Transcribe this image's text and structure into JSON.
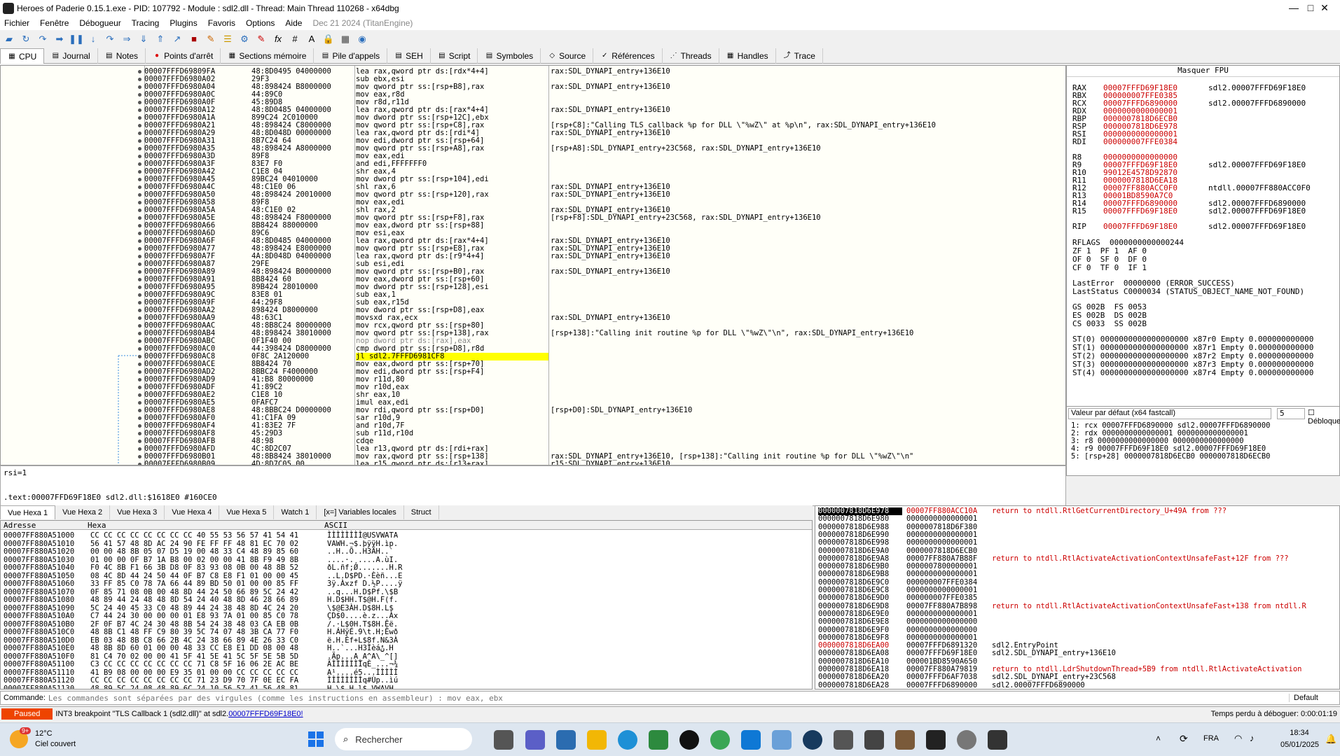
{
  "window": {
    "title": "Heroes of Paderie 0.15.1.exe - PID: 107792 - Module : sdl2.dll - Thread: Main Thread 110268 - x64dbg",
    "controls": {
      "min": "—",
      "max": "□",
      "close": "✕"
    }
  },
  "menu": {
    "items": [
      "Fichier",
      "Fenêtre",
      "Débogueur",
      "Tracing",
      "Plugins",
      "Favoris",
      "Options",
      "Aide"
    ],
    "date": "Dec 21 2024 (TitanEngine)"
  },
  "tabs": [
    "CPU",
    "Journal",
    "Notes",
    "Points d'arrêt",
    "Sections mémoire",
    "Pile d'appels",
    "SEH",
    "Script",
    "Symboles",
    "Source",
    "Références",
    "Threads",
    "Handles",
    "Trace"
  ],
  "disasm": [
    [
      "00007FFFD69809FA",
      "48:8D0495 04000000",
      "lea rax,qword ptr ds:[rdx*4+4]",
      "rax:SDL_DYNAPI_entry+136E10"
    ],
    [
      "00007FFFD6980A02",
      "29F3",
      "sub ebx,esi",
      ""
    ],
    [
      "00007FFFD6980A04",
      "48:898424 B8000000",
      "mov qword ptr ss:[rsp+B8],rax",
      "rax:SDL_DYNAPI_entry+136E10"
    ],
    [
      "00007FFFD6980A0C",
      "44:89C0",
      "mov eax,r8d",
      ""
    ],
    [
      "00007FFFD6980A0F",
      "45:89D8",
      "mov r8d,r11d",
      ""
    ],
    [
      "00007FFFD6980A12",
      "48:8D0485 04000000",
      "lea rax,qword ptr ds:[rax*4+4]",
      "rax:SDL_DYNAPI_entry+136E10"
    ],
    [
      "00007FFFD6980A1A",
      "899C24 2C010000",
      "mov dword ptr ss:[rsp+12C],ebx",
      ""
    ],
    [
      "00007FFFD6980A21",
      "48:898424 C8000000",
      "mov qword ptr ss:[rsp+C8],rax",
      "[rsp+C8]:\"Calling TLS callback %p for DLL \\\"%wZ\\\" at %p\\n\", rax:SDL_DYNAPI_entry+136E10"
    ],
    [
      "00007FFFD6980A29",
      "48:8D048D 00000000",
      "lea rax,qword ptr ds:[rdi*4]",
      "rax:SDL_DYNAPI_entry+136E10"
    ],
    [
      "00007FFFD6980A31",
      "8B7C24 64",
      "mov edi,dword ptr ss:[rsp+64]",
      ""
    ],
    [
      "00007FFFD6980A35",
      "48:898424 A8000000",
      "mov qword ptr ss:[rsp+A8],rax",
      "[rsp+A8]:SDL_DYNAPI_entry+23C568, rax:SDL_DYNAPI_entry+136E10"
    ],
    [
      "00007FFFD6980A3D",
      "89F8",
      "mov eax,edi",
      ""
    ],
    [
      "00007FFFD6980A3F",
      "83E7 F0",
      "and edi,FFFFFFF0",
      ""
    ],
    [
      "00007FFFD6980A42",
      "C1E8 04",
      "shr eax,4",
      ""
    ],
    [
      "00007FFFD6980A45",
      "89BC24 04010000",
      "mov dword ptr ss:[rsp+104],edi",
      ""
    ],
    [
      "00007FFFD6980A4C",
      "48:C1E0 06",
      "shl rax,6",
      "rax:SDL_DYNAPI_entry+136E10"
    ],
    [
      "00007FFFD6980A50",
      "48:898424 20010000",
      "mov qword ptr ss:[rsp+120],rax",
      "rax:SDL_DYNAPI_entry+136E10"
    ],
    [
      "00007FFFD6980A58",
      "89F8",
      "mov eax,edi",
      ""
    ],
    [
      "00007FFFD6980A5A",
      "48:C1E0 02",
      "shl rax,2",
      "rax:SDL_DYNAPI_entry+136E10"
    ],
    [
      "00007FFFD6980A5E",
      "48:898424 F8000000",
      "mov qword ptr ss:[rsp+F8],rax",
      "[rsp+F8]:SDL_DYNAPI_entry+23C568, rax:SDL_DYNAPI_entry+136E10"
    ],
    [
      "00007FFFD6980A66",
      "8B8424 88000000",
      "mov eax,dword ptr ss:[rsp+88]",
      ""
    ],
    [
      "00007FFFD6980A6D",
      "89C6",
      "mov esi,eax",
      ""
    ],
    [
      "00007FFFD6980A6F",
      "48:8D0485 04000000",
      "lea rax,qword ptr ds:[rax*4+4]",
      "rax:SDL_DYNAPI_entry+136E10"
    ],
    [
      "00007FFFD6980A77",
      "48:898424 E8000000",
      "mov qword ptr ss:[rsp+E8],rax",
      "rax:SDL_DYNAPI_entry+136E10"
    ],
    [
      "00007FFFD6980A7F",
      "4A:8D048D 04000000",
      "lea rax,qword ptr ds:[r9*4+4]",
      "rax:SDL_DYNAPI_entry+136E10"
    ],
    [
      "00007FFFD6980A87",
      "29FE",
      "sub esi,edi",
      ""
    ],
    [
      "00007FFFD6980A89",
      "48:898424 B0000000",
      "mov qword ptr ss:[rsp+B0],rax",
      "rax:SDL_DYNAPI_entry+136E10"
    ],
    [
      "00007FFFD6980A91",
      "8B8424 60",
      "mov eax,dword ptr ss:[rsp+60]",
      ""
    ],
    [
      "00007FFFD6980A95",
      "89B424 28010000",
      "mov dword ptr ss:[rsp+128],esi",
      ""
    ],
    [
      "00007FFFD6980A9C",
      "83E8 01",
      "sub eax,1",
      ""
    ],
    [
      "00007FFFD6980A9F",
      "44:29F8",
      "sub eax,r15d",
      ""
    ],
    [
      "00007FFFD6980AA2",
      "898424 D8000000",
      "mov dword ptr ss:[rsp+D8],eax",
      ""
    ],
    [
      "00007FFFD6980AA9",
      "48:63C1",
      "movsxd rax,ecx",
      "rax:SDL_DYNAPI_entry+136E10"
    ],
    [
      "00007FFFD6980AAC",
      "48:8B8C24 80000000",
      "mov rcx,qword ptr ss:[rsp+80]",
      ""
    ],
    [
      "00007FFFD6980AB4",
      "48:898424 38010000",
      "mov qword ptr ss:[rsp+138],rax",
      "[rsp+138]:\"Calling init routine %p for DLL \\\"%wZ\\\"\\n\", rax:SDL_DYNAPI_entry+136E10"
    ],
    [
      "00007FFFD6980ABC",
      "0F1F40 00",
      "nop dword ptr ds:[rax],eax",
      ""
    ],
    [
      "00007FFFD6980AC0",
      "44:398424 D8000000",
      "cmp dword ptr ss:[rsp+D8],r8d",
      ""
    ],
    [
      "00007FFFD6980AC8",
      "0F8C 2A120000",
      "jl sdl2.7FFFD6981CF8",
      ""
    ],
    [
      "00007FFFD6980ACE",
      "8B8424 70",
      "mov eax,dword ptr ss:[rsp+70]",
      ""
    ],
    [
      "00007FFFD6980AD2",
      "8BBC24 F4000000",
      "mov edi,dword ptr ss:[rsp+F4]",
      ""
    ],
    [
      "00007FFFD6980AD9",
      "41:B8 80000000",
      "mov r11d,80",
      ""
    ],
    [
      "00007FFFD6980ADF",
      "41:89C2",
      "mov r10d,eax",
      ""
    ],
    [
      "00007FFFD6980AE2",
      "C1E8 10",
      "shr eax,10",
      ""
    ],
    [
      "00007FFFD6980AE5",
      "0FAFC7",
      "imul eax,edi",
      ""
    ],
    [
      "00007FFFD6980AE8",
      "48:8BBC24 D0000000",
      "mov rdi,qword ptr ss:[rsp+D0]",
      "[rsp+D0]:SDL_DYNAPI_entry+136E10"
    ],
    [
      "00007FFFD6980AF0",
      "41:C1FA 09",
      "sar r10d,9",
      ""
    ],
    [
      "00007FFFD6980AF4",
      "41:83E2 7F",
      "and r10d,7F",
      ""
    ],
    [
      "00007FFFD6980AF8",
      "45:29D3",
      "sub r11d,r10d",
      ""
    ],
    [
      "00007FFFD6980AFB",
      "48:98",
      "cdqe",
      ""
    ],
    [
      "00007FFFD6980AFD",
      "4C:8D2C07",
      "lea r13,qword ptr ds:[rdi+rax]",
      ""
    ],
    [
      "00007FFFD6980B01",
      "48:8B8424 38010000",
      "mov rax,qword ptr ss:[rsp+138]",
      "rax:SDL_DYNAPI_entry+136E10, [rsp+138]:\"Calling init routine %p for DLL \\\"%wZ\\\"\\n\""
    ],
    [
      "00007FFFD6980B09",
      "4D:8D7C05 00",
      "lea r15,qword ptr ds:[r13+rax]",
      "r15:SDL_DYNAPI_entry+136E10"
    ]
  ],
  "info": {
    "line1": "rsi=1",
    "line2": ".text:00007FFD69F18E0 sdl2.dll:$1618E0 #160CE0"
  },
  "registers": {
    "header": "Masquer FPU",
    "gp": [
      [
        "RAX",
        "00007FFFD69F18E0",
        "sdl2.00007FFFD69F18E0"
      ],
      [
        "RBX",
        "000000007FFE0385",
        ""
      ],
      [
        "RCX",
        "00007FFFD6890000",
        "sdl2.00007FFFD6890000"
      ],
      [
        "RDX",
        "0000000000000001",
        ""
      ],
      [
        "RBP",
        "0000007818D6ECB0",
        ""
      ],
      [
        "RSP",
        "0000007818D6E978",
        ""
      ],
      [
        "RSI",
        "0000000000000001",
        ""
      ],
      [
        "RDI",
        "000000007FFE0384",
        ""
      ],
      [
        "R8",
        "0000000000000000",
        ""
      ],
      [
        "R9",
        "00007FFFD69F18E0",
        "sdl2.00007FFFD69F18E0"
      ],
      [
        "R10",
        "99012E4578D92870",
        ""
      ],
      [
        "R11",
        "0000007818D6EA18",
        ""
      ],
      [
        "R12",
        "00007FF880ACC0F0",
        "ntdll.00007FF880ACC0F0"
      ],
      [
        "R13",
        "00001BD8590A7C0",
        ""
      ],
      [
        "R14",
        "00007FFFD6890000",
        "sdl2.00007FFFD6890000"
      ],
      [
        "R15",
        "00007FFFD69F18E0",
        "sdl2.00007FFFD69F18E0"
      ],
      [
        "RIP",
        "00007FFFD69F18E0",
        "sdl2.00007FFFD69F18E0"
      ]
    ],
    "rflags": "RFLAGS  0000000000000244",
    "flags": [
      "ZF 1  PF 1  AF 0",
      "OF 0  SF 0  DF 0",
      "CF 0  TF 0  IF 1"
    ],
    "lasterror": "LastError  00000000 (ERROR_SUCCESS)",
    "laststatus": "LastStatus C0000034 (STATUS_OBJECT_NAME_NOT_FOUND)",
    "segs": [
      "GS 002B  FS 0053",
      "ES 002B  DS 002B",
      "CS 0033  SS 002B"
    ],
    "fpu": [
      "ST(0) 0000000000000000000 x87r0 Empty 0.000000000000",
      "ST(1) 0000000000000000000 x87r1 Empty 0.000000000000",
      "ST(2) 0000000000000000000 x87r2 Empty 0.000000000000",
      "ST(3) 0000000000000000000 x87r3 Empty 0.000000000000",
      "ST(4) 0000000000000000000 x87r4 Empty 0.000000000000"
    ]
  },
  "fastcall": {
    "select": "Valeur par défaut (x64 fastcall)",
    "count": "5",
    "unlock": "Débloquer",
    "rows": [
      "1: rcx 00007FFFD6890000 sdl2.00007FFFD6890000",
      "2: rdx 0000000000000001 0000000000000001",
      "3: r8 0000000000000000 0000000000000000",
      "4: r9 00007FFFD69F18E0 sdl2.00007FFFD69F18E0",
      "5: [rsp+28] 0000007818D6ECB0 0000007818D6ECB0"
    ]
  },
  "btabs": [
    "Vue Hexa 1",
    "Vue Hexa 2",
    "Vue Hexa 3",
    "Vue Hexa 4",
    "Vue Hexa 5",
    "Watch 1",
    "[x=] Variables locales",
    "Struct"
  ],
  "hex": {
    "headers": [
      "Adresse",
      "Hexa",
      "ASCII"
    ],
    "rows": [
      [
        "00007FF880A51000",
        "CC CC CC CC CC CC CC CC 40 55 53 56 57 41 54 41",
        "ÌÌÌÌÌÌÌÌ@USVWATA"
      ],
      [
        "00007FF880A51010",
        "56 41 57 48 8D AC 24 90 FE FF FF 48 81 EC 70 02",
        "VAWH.¬$.þÿÿH.ìp."
      ],
      [
        "00007FF880A51020",
        "00 00 48 8B 05 07 D5 19 00 48 33 C4 48 89 85 60",
        "..H..Õ..H3ÄH..`"
      ],
      [
        "00007FF880A51030",
        "01 00 00 0F B7 1A B8 00 02 00 00 41 8B F9 49 8B",
        "....·.¸....A.ùI."
      ],
      [
        "00007FF880A51040",
        "F0 4C 8B F1 66 3B D8 0F 83 93 08 0B 00 48 8B 52",
        "ðL.ñf;Ø.......H.R"
      ],
      [
        "00007FF880A51050",
        "08 4C 8D 44 24 50 44 0F B7 C8 E8 F1 01 00 00 45",
        "..L.D$PD.·Èèñ...E"
      ],
      [
        "00007FF880A51060",
        "33 FF 85 C0 78 7A 66 44 89 BD 50 01 00 00 85 FF",
        "3ÿ.Àxzf D.½P....ÿ"
      ],
      [
        "00007FF880A51070",
        "0F 85 71 08 0B 00 48 8D 44 24 50 66 89 5C 24 42",
        "..q...H.D$Pf.\\$B"
      ],
      [
        "00007FF880A51080",
        "48 89 44 24 48 48 8D 54 24 40 48 8D 46 28 66 89",
        "H.D$HH.T$@H.F(f."
      ],
      [
        "00007FF880A51090",
        "5C 24 40 45 33 C0 48 89 44 24 38 48 8D 4C 24 20",
        "\\$@E3ÀH.D$8H.L$ "
      ],
      [
        "00007FF880A510A0",
        "C7 44 24 30 00 00 00 01 E8 93 7A 01 00 85 C0 78",
        "ÇD$0....è.z...Àx"
      ],
      [
        "00007FF880A510B0",
        "2F 0F B7 4C 24 30 48 8B 54 24 38 48 03 CA EB 0B",
        "/.·L$0H.T$8H.Êë."
      ],
      [
        "00007FF880A510C0",
        "48 8B C1 48 FF C9 80 39 5C 74 07 48 3B CA 77 F0",
        "H.ÁHÿÉ.9\\t.H;Êwð"
      ],
      [
        "00007FF880A510D0",
        "EB 03 48 8B C8 66 2B 4C 24 38 66 89 4E 26 33 C0",
        "ë.H.Èf+L$8f.N&3À"
      ],
      [
        "00007FF880A510E0",
        "48 8B 8D 60 01 00 00 48 33 CC E8 E1 DD 08 00 48",
        "H..`...H3Ìèáݨ.H"
      ],
      [
        "00007FF880A510F0",
        "81 C4 70 02 00 00 41 5F 41 5E 41 5C 5F 5E 5B 5D",
        ".Äp...A_A^A\\_^[]"
      ],
      [
        "00007FF880A51100",
        "C3 CC CC CC CC CC CC CC 71 C8 5F 16 06 2E AC BE",
        "ÃÌÌÌÌÌÌÌqÈ_...¬¾"
      ],
      [
        "00007FF880A51110",
        "41 B9 08 00 00 00 E9 35 01 00 00 CC CC CC CC CC",
        "A¹....é5...ÌÌÌÌÌ"
      ],
      [
        "00007FF880A51120",
        "CC CC CC CC CC CC CC CC 71 23 D9 70 7F 0E EC FA",
        "ÌÌÌÌÌÌÌÌq#Ùp..ìú"
      ],
      [
        "00007FF880A51130",
        "48 89 5C 24 08 48 89 6C 24 10 56 57 41 56 48 81",
        "H.\\$.H.l$.VWAVH."
      ]
    ]
  },
  "stack": {
    "rows": [
      [
        "0000007818D6E978",
        "00007FF880ACC10A",
        "return to ntdll.RtlGetCurrentDirectory_U+49A from ???"
      ],
      [
        "0000007818D6E980",
        "0000000000000001",
        ""
      ],
      [
        "0000007818D6E988",
        "0000007818D6F380",
        ""
      ],
      [
        "0000007818D6E990",
        "0000000000000001",
        ""
      ],
      [
        "0000007818D6E998",
        "0000000000000001",
        ""
      ],
      [
        "0000007818D6E9A0",
        "0000007818D6ECB0",
        ""
      ],
      [
        "0000007818D6E9A8",
        "00007FF880A7B88F",
        "return to ntdll.RtlActivateActivationContextUnsafeFast+12F from ???"
      ],
      [
        "0000007818D6E9B0",
        "0000007800000001",
        ""
      ],
      [
        "0000007818D6E9B8",
        "0000000000000001",
        ""
      ],
      [
        "0000007818D6E9C0",
        "000000007FFE0384",
        ""
      ],
      [
        "0000007818D6E9C8",
        "0000000000000001",
        ""
      ],
      [
        "0000007818D6E9D0",
        "000000007FFE0385",
        ""
      ],
      [
        "0000007818D6E9D8",
        "00007FF880A7B898",
        "return to ntdll.RtlActivateActivationContextUnsafeFast+138 from ntdll.R"
      ],
      [
        "0000007818D6E9E0",
        "0000000000000001",
        ""
      ],
      [
        "0000007818D6E9E8",
        "0000000000000000",
        ""
      ],
      [
        "0000007818D6E9F0",
        "0000000000000000",
        ""
      ],
      [
        "0000007818D6E9F8",
        "0000000000000001",
        ""
      ],
      [
        "0000007818D6EA00",
        "00007FFFD6891320",
        "sdl2.EntryPoint"
      ],
      [
        "0000007818D6EA08",
        "00007FFFD69F18E0",
        "sdl2.SDL_DYNAPI_entry+136E10"
      ],
      [
        "0000007818D6EA10",
        "000001BD8590A650",
        ""
      ],
      [
        "0000007818D6EA18",
        "00007FF880A79819",
        "return to ntdll.LdrShutdownThread+5B9 from ntdll.RtlActivateActivation"
      ],
      [
        "0000007818D6EA20",
        "00007FFFD6AF7038",
        "sdl2.SDL_DYNAPI_entry+23C568"
      ],
      [
        "0000007818D6EA28",
        "00007FFFD6890000",
        "sdl2.00007FFFD6890000"
      ]
    ]
  },
  "command": {
    "label": "Commande:",
    "placeholder": "Les commandes sont séparées par des virgules (comme les instructions en assembleur) : mov eax, ebx",
    "mode": "Default"
  },
  "status": {
    "state": "Paused",
    "message": "INT3 breakpoint \"TLS Callback 1 (sdl2.dll)\" at sdl2.",
    "link": "00007FFFD69F18E0!",
    "time": "Temps perdu à déboguer: 0:00:01:19"
  },
  "taskbar": {
    "temp": "12°C",
    "weather": "Ciel couvert",
    "badge": "9+",
    "search": "Rechercher",
    "lang": "FRA",
    "time": "18:34",
    "date": "05/01/2025"
  }
}
